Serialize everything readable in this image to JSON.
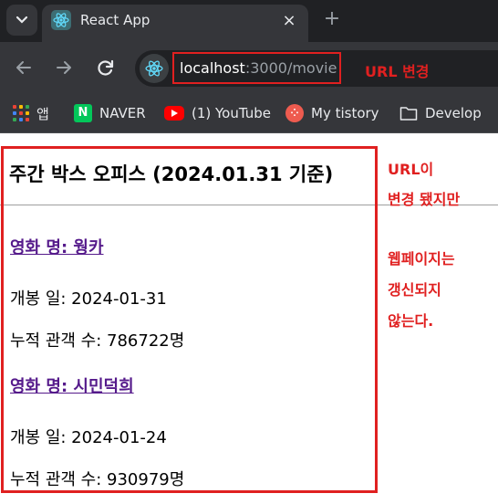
{
  "browser": {
    "tab": {
      "title": "React App",
      "close_glyph": "×"
    },
    "new_tab_glyph": "+",
    "address": {
      "host": "localhost",
      "path": ":3000/movie"
    },
    "bookmarks": [
      {
        "label": "앱",
        "icon": "apps-grid-icon"
      },
      {
        "label": "NAVER",
        "icon": "naver-icon"
      },
      {
        "label": "(1) YouTube",
        "icon": "youtube-icon"
      },
      {
        "label": "My tistory",
        "icon": "tistory-icon"
      },
      {
        "label": "Develop",
        "icon": "folder-icon"
      }
    ]
  },
  "annotations": {
    "url_note": "URL 변경",
    "side_note_lines": [
      "URL이",
      "변경 됐지만",
      "웹페이지는",
      "갱신되지",
      "않는다."
    ]
  },
  "page": {
    "title": "주간 박스 오피스 (2024.01.31 기준)",
    "movies": [
      {
        "name": "영화 명: 웡카",
        "open_date": "개봉 일: 2024-01-31",
        "audience": "누적 관객 수: 786722명"
      },
      {
        "name": "영화 명: 시민덕희",
        "open_date": "개봉 일: 2024-01-24",
        "audience": "누적 관객 수: 930979명"
      }
    ]
  },
  "colors": {
    "annotation_red": "#e02020",
    "visited_link": "#551a8b",
    "chrome_dark": "#202124",
    "chrome_toolbar": "#35363a"
  }
}
